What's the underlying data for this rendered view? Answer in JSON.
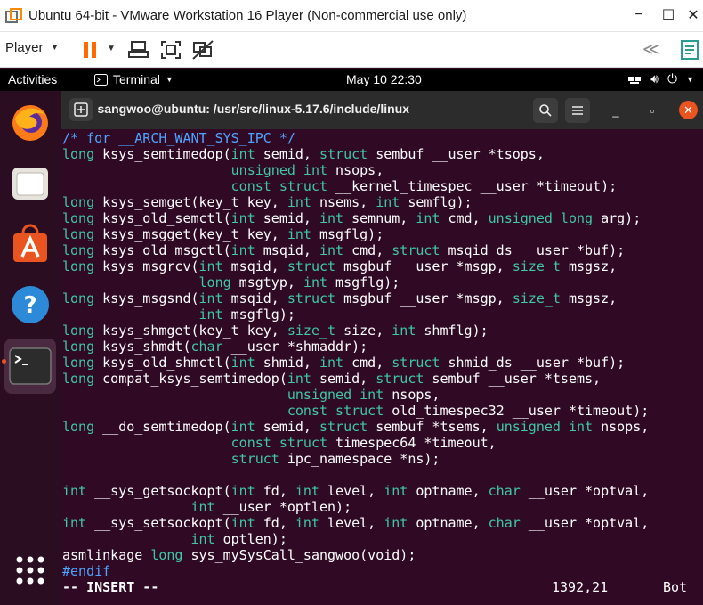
{
  "vmware": {
    "window_title": "Ubuntu 64-bit - VMware Workstation 16 Player (Non-commercial use only)",
    "player_menu_label": "Player",
    "minimize_glyph": "−",
    "maximize_glyph": "☐",
    "close_glyph": "✕",
    "toolbar_icons": [
      "pause-icon",
      "send-ctrl-alt-del-icon",
      "fit-guest-icon",
      "unity-disabled-icon",
      "collapse-toolbar-icon",
      "notes-icon"
    ],
    "accent_color": "#ff6a00"
  },
  "ubuntu_top_bar": {
    "activities_label": "Activities",
    "app_menu_label": "Terminal",
    "clock": "May 10  22:30"
  },
  "dock": {
    "items": [
      {
        "name": "firefox"
      },
      {
        "name": "files"
      },
      {
        "name": "ubuntu-software"
      },
      {
        "name": "help"
      },
      {
        "name": "terminal",
        "active": true
      },
      {
        "name": "show-applications"
      }
    ]
  },
  "terminal": {
    "title": "sangwoo@ubuntu: /usr/src/linux-5.17.6/include/linux",
    "close_glyph": "✕",
    "maximize_glyph": "▫",
    "minimize_glyph": "_",
    "lines": [
      [
        [
          "comment",
          "/* for __ARCH_WANT_SYS_IPC */"
        ]
      ],
      [
        [
          "type",
          "long"
        ],
        [
          "text",
          " ksys_semtimedop("
        ],
        [
          "type",
          "int"
        ],
        [
          "text",
          " semid, "
        ],
        [
          "type",
          "struct"
        ],
        [
          "text",
          " sembuf __user *tsops,"
        ]
      ],
      [
        [
          "text",
          "                     "
        ],
        [
          "type",
          "unsigned int"
        ],
        [
          "text",
          " nsops,"
        ]
      ],
      [
        [
          "text",
          "                     "
        ],
        [
          "type",
          "const struct"
        ],
        [
          "text",
          " __kernel_timespec __user *timeout);"
        ]
      ],
      [
        [
          "type",
          "long"
        ],
        [
          "text",
          " ksys_semget(key_t key, "
        ],
        [
          "type",
          "int"
        ],
        [
          "text",
          " nsems, "
        ],
        [
          "type",
          "int"
        ],
        [
          "text",
          " semflg);"
        ]
      ],
      [
        [
          "type",
          "long"
        ],
        [
          "text",
          " ksys_old_semctl("
        ],
        [
          "type",
          "int"
        ],
        [
          "text",
          " semid, "
        ],
        [
          "type",
          "int"
        ],
        [
          "text",
          " semnum, "
        ],
        [
          "type",
          "int"
        ],
        [
          "text",
          " cmd, "
        ],
        [
          "type",
          "unsigned long"
        ],
        [
          "text",
          " arg);"
        ]
      ],
      [
        [
          "type",
          "long"
        ],
        [
          "text",
          " ksys_msgget(key_t key, "
        ],
        [
          "type",
          "int"
        ],
        [
          "text",
          " msgflg);"
        ]
      ],
      [
        [
          "type",
          "long"
        ],
        [
          "text",
          " ksys_old_msgctl("
        ],
        [
          "type",
          "int"
        ],
        [
          "text",
          " msqid, "
        ],
        [
          "type",
          "int"
        ],
        [
          "text",
          " cmd, "
        ],
        [
          "type",
          "struct"
        ],
        [
          "text",
          " msqid_ds __user *buf);"
        ]
      ],
      [
        [
          "type",
          "long"
        ],
        [
          "text",
          " ksys_msgrcv("
        ],
        [
          "type",
          "int"
        ],
        [
          "text",
          " msqid, "
        ],
        [
          "type",
          "struct"
        ],
        [
          "text",
          " msgbuf __user *msgp, "
        ],
        [
          "type",
          "size_t"
        ],
        [
          "text",
          " msgsz,"
        ]
      ],
      [
        [
          "text",
          "                 "
        ],
        [
          "type",
          "long"
        ],
        [
          "text",
          " msgtyp, "
        ],
        [
          "type",
          "int"
        ],
        [
          "text",
          " msgflg);"
        ]
      ],
      [
        [
          "type",
          "long"
        ],
        [
          "text",
          " ksys_msgsnd("
        ],
        [
          "type",
          "int"
        ],
        [
          "text",
          " msqid, "
        ],
        [
          "type",
          "struct"
        ],
        [
          "text",
          " msgbuf __user *msgp, "
        ],
        [
          "type",
          "size_t"
        ],
        [
          "text",
          " msgsz,"
        ]
      ],
      [
        [
          "text",
          "                 "
        ],
        [
          "type",
          "int"
        ],
        [
          "text",
          " msgflg);"
        ]
      ],
      [
        [
          "type",
          "long"
        ],
        [
          "text",
          " ksys_shmget(key_t key, "
        ],
        [
          "type",
          "size_t"
        ],
        [
          "text",
          " size, "
        ],
        [
          "type",
          "int"
        ],
        [
          "text",
          " shmflg);"
        ]
      ],
      [
        [
          "type",
          "long"
        ],
        [
          "text",
          " ksys_shmdt("
        ],
        [
          "type",
          "char"
        ],
        [
          "text",
          " __user *shmaddr);"
        ]
      ],
      [
        [
          "type",
          "long"
        ],
        [
          "text",
          " ksys_old_shmctl("
        ],
        [
          "type",
          "int"
        ],
        [
          "text",
          " shmid, "
        ],
        [
          "type",
          "int"
        ],
        [
          "text",
          " cmd, "
        ],
        [
          "type",
          "struct"
        ],
        [
          "text",
          " shmid_ds __user *buf);"
        ]
      ],
      [
        [
          "type",
          "long"
        ],
        [
          "text",
          " compat_ksys_semtimedop("
        ],
        [
          "type",
          "int"
        ],
        [
          "text",
          " semid, "
        ],
        [
          "type",
          "struct"
        ],
        [
          "text",
          " sembuf __user *tsems,"
        ]
      ],
      [
        [
          "text",
          "                            "
        ],
        [
          "type",
          "unsigned int"
        ],
        [
          "text",
          " nsops,"
        ]
      ],
      [
        [
          "text",
          "                            "
        ],
        [
          "type",
          "const struct"
        ],
        [
          "text",
          " old_timespec32 __user *timeout);"
        ]
      ],
      [
        [
          "type",
          "long"
        ],
        [
          "text",
          " __do_semtimedop("
        ],
        [
          "type",
          "int"
        ],
        [
          "text",
          " semid, "
        ],
        [
          "type",
          "struct"
        ],
        [
          "text",
          " sembuf *tsems, "
        ],
        [
          "type",
          "unsigned int"
        ],
        [
          "text",
          " nsops,"
        ]
      ],
      [
        [
          "text",
          "                     "
        ],
        [
          "type",
          "const struct"
        ],
        [
          "text",
          " timespec64 *timeout,"
        ]
      ],
      [
        [
          "text",
          "                     "
        ],
        [
          "type",
          "struct"
        ],
        [
          "text",
          " ipc_namespace *ns);"
        ]
      ],
      [
        [
          "text",
          ""
        ]
      ],
      [
        [
          "type",
          "int"
        ],
        [
          "text",
          " __sys_getsockopt("
        ],
        [
          "type",
          "int"
        ],
        [
          "text",
          " fd, "
        ],
        [
          "type",
          "int"
        ],
        [
          "text",
          " level, "
        ],
        [
          "type",
          "int"
        ],
        [
          "text",
          " optname, "
        ],
        [
          "type",
          "char"
        ],
        [
          "text",
          " __user *optval,"
        ]
      ],
      [
        [
          "text",
          "                "
        ],
        [
          "type",
          "int"
        ],
        [
          "text",
          " __user *optlen);"
        ]
      ],
      [
        [
          "type",
          "int"
        ],
        [
          "text",
          " __sys_setsockopt("
        ],
        [
          "type",
          "int"
        ],
        [
          "text",
          " fd, "
        ],
        [
          "type",
          "int"
        ],
        [
          "text",
          " level, "
        ],
        [
          "type",
          "int"
        ],
        [
          "text",
          " optname, "
        ],
        [
          "type",
          "char"
        ],
        [
          "text",
          " __user *optval,"
        ]
      ],
      [
        [
          "text",
          "                "
        ],
        [
          "type",
          "int"
        ],
        [
          "text",
          " optlen);"
        ]
      ],
      [
        [
          "text",
          "asmlinkage "
        ],
        [
          "type",
          "long"
        ],
        [
          "text",
          " sys_mySysCall_sangwoo(void);"
        ]
      ],
      [
        [
          "pre",
          "#endif"
        ]
      ]
    ],
    "status_bar": {
      "mode": "-- INSERT --",
      "position": "1392,21",
      "scroll": "Bot"
    },
    "colors": {
      "background": "#300a24",
      "type_keyword": "#3fc7a5",
      "comment": "#4ea3ff",
      "text": "#ffffff"
    }
  }
}
